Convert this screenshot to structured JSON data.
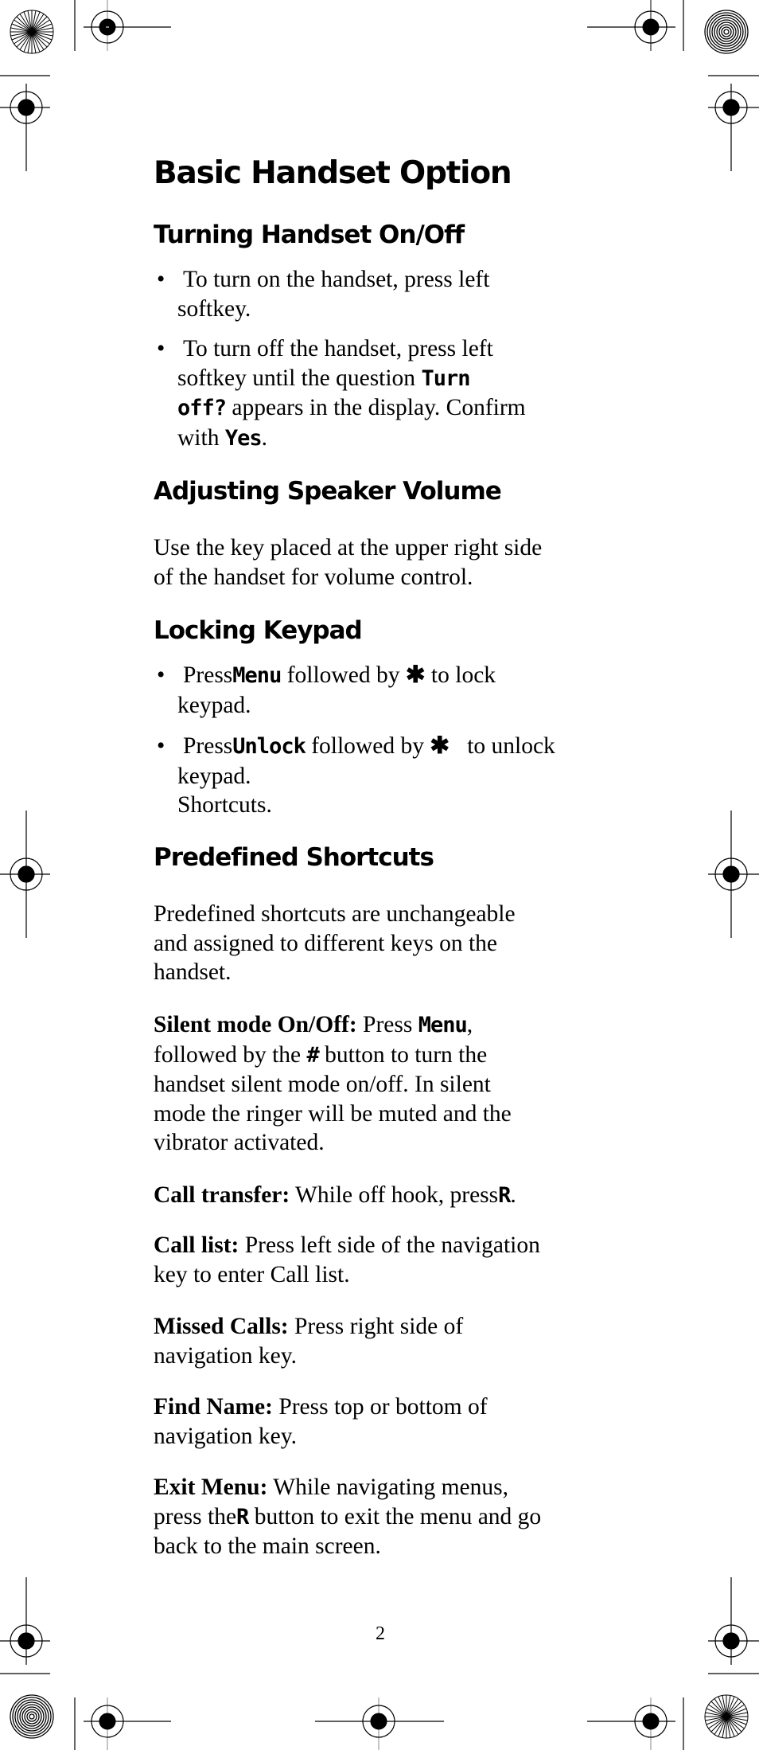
{
  "title": "Basic Handset Option",
  "sections": {
    "turning": {
      "heading": "Turning Handset On/Off",
      "bullet1": {
        "line1": "To turn on the handset, press left",
        "line2": "softkey."
      },
      "bullet2": {
        "line1": "To turn off the handset, press left",
        "line2_text": "softkey until the question ",
        "line2_key": "Turn",
        "line3_key": "off?",
        "line3_text": " appears in the display. Confirm",
        "line4_text": "with ",
        "line4_key": "Yes",
        "line4_end": "."
      }
    },
    "volume": {
      "heading": "Adjusting Speaker Volume",
      "line1": "Use the key placed at the upper right side",
      "line2": "of the handset for volume control."
    },
    "locking": {
      "heading": "Locking Keypad",
      "bullet1": {
        "prefix": "Press",
        "key": "Menu",
        "middle": " followed by ",
        "symbol": "✱",
        "suffix": " to lock",
        "line2": "keypad."
      },
      "bullet2": {
        "prefix": "Press",
        "key": "Unlock",
        "middle": " followed by ",
        "symbol": "✱",
        "suffix": "   to unlock",
        "line2": "keypad.",
        "line3": "Shortcuts."
      }
    },
    "shortcuts": {
      "heading": "Predefined Shortcuts",
      "intro": [
        "Predefined shortcuts are unchangeable",
        "and assigned to different keys on the",
        "handset."
      ],
      "silent": {
        "label": "Silent mode On/Off:",
        "l1_text": " Press ",
        "l1_key": "Menu",
        "l1_end": ",",
        "l2_text": "followed by the ",
        "l2_key": "#",
        "l2_end": " button to turn the",
        "l3": "handset silent mode on/off. In silent",
        "l4": "mode the ringer will be muted and the",
        "l5": "vibrator activated."
      },
      "transfer": {
        "label": "Call transfer:",
        "text": " While off hook, press",
        "key": "R",
        "end": "."
      },
      "calllist": {
        "label": "Call list:",
        "text": " Press left side of the navigation",
        "line2": "key to enter Call list."
      },
      "missed": {
        "label": "Missed Calls:",
        "text": " Press right side of",
        "line2": "navigation key."
      },
      "findname": {
        "label": "Find Name:",
        "text": " Press top or bottom of",
        "line2": "navigation key."
      },
      "exitmenu": {
        "label": "Exit Menu:",
        "text": " While navigating menus,",
        "l2_text": "press the",
        "l2_key": "R",
        "l2_end": " button to exit the menu and go",
        "line3": "back to the main screen."
      }
    }
  },
  "page_number": "2"
}
